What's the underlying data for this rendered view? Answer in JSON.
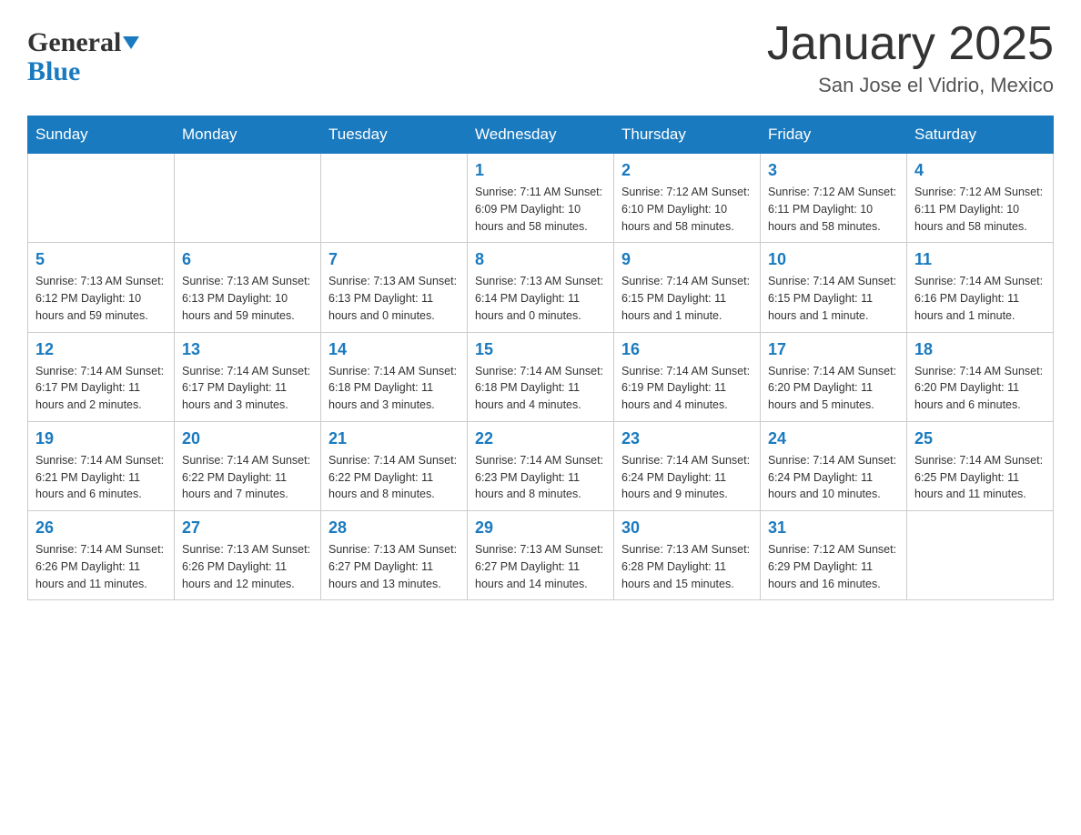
{
  "header": {
    "logo_general": "General",
    "logo_blue": "Blue",
    "title": "January 2025",
    "subtitle": "San Jose el Vidrio, Mexico"
  },
  "days_of_week": [
    "Sunday",
    "Monday",
    "Tuesday",
    "Wednesday",
    "Thursday",
    "Friday",
    "Saturday"
  ],
  "weeks": [
    [
      {
        "day": "",
        "info": ""
      },
      {
        "day": "",
        "info": ""
      },
      {
        "day": "",
        "info": ""
      },
      {
        "day": "1",
        "info": "Sunrise: 7:11 AM\nSunset: 6:09 PM\nDaylight: 10 hours\nand 58 minutes."
      },
      {
        "day": "2",
        "info": "Sunrise: 7:12 AM\nSunset: 6:10 PM\nDaylight: 10 hours\nand 58 minutes."
      },
      {
        "day": "3",
        "info": "Sunrise: 7:12 AM\nSunset: 6:11 PM\nDaylight: 10 hours\nand 58 minutes."
      },
      {
        "day": "4",
        "info": "Sunrise: 7:12 AM\nSunset: 6:11 PM\nDaylight: 10 hours\nand 58 minutes."
      }
    ],
    [
      {
        "day": "5",
        "info": "Sunrise: 7:13 AM\nSunset: 6:12 PM\nDaylight: 10 hours\nand 59 minutes."
      },
      {
        "day": "6",
        "info": "Sunrise: 7:13 AM\nSunset: 6:13 PM\nDaylight: 10 hours\nand 59 minutes."
      },
      {
        "day": "7",
        "info": "Sunrise: 7:13 AM\nSunset: 6:13 PM\nDaylight: 11 hours\nand 0 minutes."
      },
      {
        "day": "8",
        "info": "Sunrise: 7:13 AM\nSunset: 6:14 PM\nDaylight: 11 hours\nand 0 minutes."
      },
      {
        "day": "9",
        "info": "Sunrise: 7:14 AM\nSunset: 6:15 PM\nDaylight: 11 hours\nand 1 minute."
      },
      {
        "day": "10",
        "info": "Sunrise: 7:14 AM\nSunset: 6:15 PM\nDaylight: 11 hours\nand 1 minute."
      },
      {
        "day": "11",
        "info": "Sunrise: 7:14 AM\nSunset: 6:16 PM\nDaylight: 11 hours\nand 1 minute."
      }
    ],
    [
      {
        "day": "12",
        "info": "Sunrise: 7:14 AM\nSunset: 6:17 PM\nDaylight: 11 hours\nand 2 minutes."
      },
      {
        "day": "13",
        "info": "Sunrise: 7:14 AM\nSunset: 6:17 PM\nDaylight: 11 hours\nand 3 minutes."
      },
      {
        "day": "14",
        "info": "Sunrise: 7:14 AM\nSunset: 6:18 PM\nDaylight: 11 hours\nand 3 minutes."
      },
      {
        "day": "15",
        "info": "Sunrise: 7:14 AM\nSunset: 6:18 PM\nDaylight: 11 hours\nand 4 minutes."
      },
      {
        "day": "16",
        "info": "Sunrise: 7:14 AM\nSunset: 6:19 PM\nDaylight: 11 hours\nand 4 minutes."
      },
      {
        "day": "17",
        "info": "Sunrise: 7:14 AM\nSunset: 6:20 PM\nDaylight: 11 hours\nand 5 minutes."
      },
      {
        "day": "18",
        "info": "Sunrise: 7:14 AM\nSunset: 6:20 PM\nDaylight: 11 hours\nand 6 minutes."
      }
    ],
    [
      {
        "day": "19",
        "info": "Sunrise: 7:14 AM\nSunset: 6:21 PM\nDaylight: 11 hours\nand 6 minutes."
      },
      {
        "day": "20",
        "info": "Sunrise: 7:14 AM\nSunset: 6:22 PM\nDaylight: 11 hours\nand 7 minutes."
      },
      {
        "day": "21",
        "info": "Sunrise: 7:14 AM\nSunset: 6:22 PM\nDaylight: 11 hours\nand 8 minutes."
      },
      {
        "day": "22",
        "info": "Sunrise: 7:14 AM\nSunset: 6:23 PM\nDaylight: 11 hours\nand 8 minutes."
      },
      {
        "day": "23",
        "info": "Sunrise: 7:14 AM\nSunset: 6:24 PM\nDaylight: 11 hours\nand 9 minutes."
      },
      {
        "day": "24",
        "info": "Sunrise: 7:14 AM\nSunset: 6:24 PM\nDaylight: 11 hours\nand 10 minutes."
      },
      {
        "day": "25",
        "info": "Sunrise: 7:14 AM\nSunset: 6:25 PM\nDaylight: 11 hours\nand 11 minutes."
      }
    ],
    [
      {
        "day": "26",
        "info": "Sunrise: 7:14 AM\nSunset: 6:26 PM\nDaylight: 11 hours\nand 11 minutes."
      },
      {
        "day": "27",
        "info": "Sunrise: 7:13 AM\nSunset: 6:26 PM\nDaylight: 11 hours\nand 12 minutes."
      },
      {
        "day": "28",
        "info": "Sunrise: 7:13 AM\nSunset: 6:27 PM\nDaylight: 11 hours\nand 13 minutes."
      },
      {
        "day": "29",
        "info": "Sunrise: 7:13 AM\nSunset: 6:27 PM\nDaylight: 11 hours\nand 14 minutes."
      },
      {
        "day": "30",
        "info": "Sunrise: 7:13 AM\nSunset: 6:28 PM\nDaylight: 11 hours\nand 15 minutes."
      },
      {
        "day": "31",
        "info": "Sunrise: 7:12 AM\nSunset: 6:29 PM\nDaylight: 11 hours\nand 16 minutes."
      },
      {
        "day": "",
        "info": ""
      }
    ]
  ]
}
